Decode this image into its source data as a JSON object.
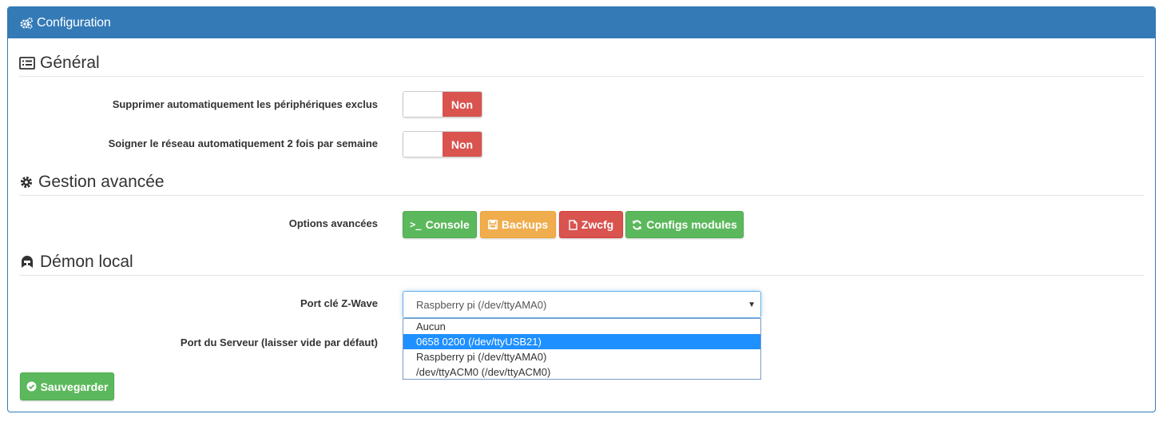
{
  "panel": {
    "title": "Configuration",
    "header_color": "#337ab7"
  },
  "sections": {
    "general": {
      "title": "Général",
      "icon": "list-icon"
    },
    "advanced": {
      "title": "Gestion avancée",
      "icon": "gear-icon"
    },
    "daemon": {
      "title": "Démon local",
      "icon": "helmet-icon"
    }
  },
  "settings": {
    "auto_remove": {
      "label": "Supprimer automatiquement les périphériques exclus",
      "state": "Non"
    },
    "auto_heal": {
      "label": "Soigner le réseau automatiquement 2 fois par semaine",
      "state": "Non"
    }
  },
  "advanced_options": {
    "label": "Options avancées",
    "buttons": {
      "console": "Console",
      "backups": "Backups",
      "zwcfg": "Zwcfg",
      "configs": "Configs modules"
    }
  },
  "daemon": {
    "port_label": "Port clé Z-Wave",
    "port_selected": "Raspberry pi (/dev/ttyAMA0)",
    "port_options": [
      "Aucun",
      "0658 0200 (/dev/ttyUSB21)",
      "Raspberry pi (/dev/ttyAMA0)",
      "/dev/ttyACM0 (/dev/ttyACM0)"
    ],
    "highlighted_option_index": 1,
    "server_port_label": "Port du Serveur (laisser vide par défaut)"
  },
  "save_label": "Sauvegarder",
  "colors": {
    "success": "#5cb85c",
    "warning": "#f0ad4e",
    "danger": "#d9534f",
    "highlight": "#1e90ff"
  }
}
